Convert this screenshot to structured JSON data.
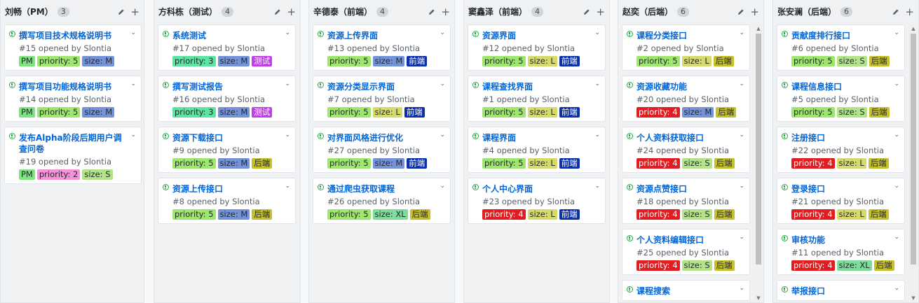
{
  "colors": {
    "pm": "#7ee57e",
    "priority5": "#9ee66e",
    "priority3": "#5ee3a0",
    "priority2": "#f693d8",
    "priority4": "#e11d21",
    "sizeM": "#7392d8",
    "sizeS": "#b2e389",
    "sizeL": "#d6d96b",
    "sizeXL": "#7fdc9b",
    "frontend": "#0b30a8",
    "backend": "#c6c02a",
    "test": "#c23ee6"
  },
  "columns": [
    {
      "title": "刘畅（PM）",
      "count": "3",
      "cards": [
        {
          "title": "撰写项目技术规格说明书",
          "meta": "#15 opened by Slontia",
          "labels": [
            {
              "text": "PM",
              "kind": "pm"
            },
            {
              "text": "priority: 5",
              "kind": "priority5"
            },
            {
              "text": "size: M",
              "kind": "sizeM"
            }
          ]
        },
        {
          "title": "撰写项目功能规格说明书",
          "meta": "#14 opened by Slontia",
          "labels": [
            {
              "text": "PM",
              "kind": "pm"
            },
            {
              "text": "priority: 5",
              "kind": "priority5"
            },
            {
              "text": "size: M",
              "kind": "sizeM"
            }
          ]
        },
        {
          "title": "发布Alpha阶段后期用户调查问卷",
          "meta": "#19 opened by Slontia",
          "labels": [
            {
              "text": "PM",
              "kind": "pm"
            },
            {
              "text": "priority: 2",
              "kind": "priority2"
            },
            {
              "text": "size: S",
              "kind": "sizeS"
            }
          ]
        }
      ]
    },
    {
      "title": "方科栋（测试）",
      "count": "4",
      "cards": [
        {
          "title": "系统测试",
          "meta": "#17 opened by Slontia",
          "labels": [
            {
              "text": "priority: 3",
              "kind": "priority3"
            },
            {
              "text": "size: M",
              "kind": "sizeM"
            },
            {
              "text": "测试",
              "kind": "test"
            }
          ]
        },
        {
          "title": "撰写测试报告",
          "meta": "#16 opened by Slontia",
          "labels": [
            {
              "text": "priority: 3",
              "kind": "priority3"
            },
            {
              "text": "size: M",
              "kind": "sizeM"
            },
            {
              "text": "测试",
              "kind": "test"
            }
          ]
        },
        {
          "title": "资源下载接口",
          "meta": "#9 opened by Slontia",
          "labels": [
            {
              "text": "priority: 5",
              "kind": "priority5"
            },
            {
              "text": "size: M",
              "kind": "sizeM"
            },
            {
              "text": "后端",
              "kind": "backend"
            }
          ]
        },
        {
          "title": "资源上传接口",
          "meta": "#8 opened by Slontia",
          "labels": [
            {
              "text": "priority: 5",
              "kind": "priority5"
            },
            {
              "text": "size: M",
              "kind": "sizeM"
            },
            {
              "text": "后端",
              "kind": "backend"
            }
          ]
        }
      ]
    },
    {
      "title": "辛德泰（前端）",
      "count": "4",
      "cards": [
        {
          "title": "资源上传界面",
          "meta": "#13 opened by Slontia",
          "labels": [
            {
              "text": "priority: 5",
              "kind": "priority5"
            },
            {
              "text": "size: M",
              "kind": "sizeM"
            },
            {
              "text": "前端",
              "kind": "frontend"
            }
          ]
        },
        {
          "title": "资源分类显示界面",
          "meta": "#7 opened by Slontia",
          "labels": [
            {
              "text": "priority: 5",
              "kind": "priority5"
            },
            {
              "text": "size: L",
              "kind": "sizeL"
            },
            {
              "text": "前端",
              "kind": "frontend"
            }
          ]
        },
        {
          "title": "对界面风格进行优化",
          "meta": "#27 opened by Slontia",
          "labels": [
            {
              "text": "priority: 5",
              "kind": "priority5"
            },
            {
              "text": "size: M",
              "kind": "sizeM"
            },
            {
              "text": "前端",
              "kind": "frontend"
            }
          ]
        },
        {
          "title": "通过爬虫获取课程",
          "meta": "#26 opened by Slontia",
          "labels": [
            {
              "text": "priority: 5",
              "kind": "priority5"
            },
            {
              "text": "size: XL",
              "kind": "sizeXL"
            },
            {
              "text": "后端",
              "kind": "backend"
            }
          ]
        }
      ]
    },
    {
      "title": "窦鑫泽（前端）",
      "count": "4",
      "cards": [
        {
          "title": "资源界面",
          "meta": "#12 opened by Slontia",
          "labels": [
            {
              "text": "priority: 5",
              "kind": "priority5"
            },
            {
              "text": "size: L",
              "kind": "sizeL"
            },
            {
              "text": "前端",
              "kind": "frontend"
            }
          ]
        },
        {
          "title": "课程查找界面",
          "meta": "#1 opened by Slontia",
          "labels": [
            {
              "text": "priority: 5",
              "kind": "priority5"
            },
            {
              "text": "size: L",
              "kind": "sizeL"
            },
            {
              "text": "前端",
              "kind": "frontend"
            }
          ]
        },
        {
          "title": "课程界面",
          "meta": "#4 opened by Slontia",
          "labels": [
            {
              "text": "priority: 5",
              "kind": "priority5"
            },
            {
              "text": "size: L",
              "kind": "sizeL"
            },
            {
              "text": "前端",
              "kind": "frontend"
            }
          ]
        },
        {
          "title": "个人中心界面",
          "meta": "#23 opened by Slontia",
          "labels": [
            {
              "text": "priority: 4",
              "kind": "priority4"
            },
            {
              "text": "size: L",
              "kind": "sizeL"
            },
            {
              "text": "前端",
              "kind": "frontend"
            }
          ]
        }
      ]
    },
    {
      "title": "赵奕（后端）",
      "count": "6",
      "cards": [
        {
          "title": "课程分类接口",
          "meta": "#2 opened by Slontia",
          "labels": [
            {
              "text": "priority: 5",
              "kind": "priority5"
            },
            {
              "text": "size: L",
              "kind": "sizeL"
            },
            {
              "text": "后端",
              "kind": "backend"
            }
          ]
        },
        {
          "title": "资源收藏功能",
          "meta": "#20 opened by Slontia",
          "labels": [
            {
              "text": "priority: 4",
              "kind": "priority4"
            },
            {
              "text": "size: M",
              "kind": "sizeM"
            },
            {
              "text": "后端",
              "kind": "backend"
            }
          ]
        },
        {
          "title": "个人资料获取接口",
          "meta": "#24 opened by Slontia",
          "labels": [
            {
              "text": "priority: 4",
              "kind": "priority4"
            },
            {
              "text": "size: S",
              "kind": "sizeS"
            },
            {
              "text": "后端",
              "kind": "backend"
            }
          ]
        },
        {
          "title": "资源点赞接口",
          "meta": "#18 opened by Slontia",
          "labels": [
            {
              "text": "priority: 4",
              "kind": "priority4"
            },
            {
              "text": "size: S",
              "kind": "sizeS"
            },
            {
              "text": "后端",
              "kind": "backend"
            }
          ]
        },
        {
          "title": "个人资料编辑接口",
          "meta": "#25 opened by Slontia",
          "labels": [
            {
              "text": "priority: 4",
              "kind": "priority4"
            },
            {
              "text": "size: S",
              "kind": "sizeS"
            },
            {
              "text": "后端",
              "kind": "backend"
            }
          ]
        },
        {
          "title": "课程搜索",
          "meta": "",
          "labels": []
        }
      ]
    },
    {
      "title": "张安澜（后端）",
      "count": "6",
      "cards": [
        {
          "title": "贡献度排行接口",
          "meta": "#6 opened by Slontia",
          "labels": [
            {
              "text": "priority: 5",
              "kind": "priority5"
            },
            {
              "text": "size: S",
              "kind": "sizeS"
            },
            {
              "text": "后端",
              "kind": "backend"
            }
          ]
        },
        {
          "title": "课程信息接口",
          "meta": "#5 opened by Slontia",
          "labels": [
            {
              "text": "priority: 5",
              "kind": "priority5"
            },
            {
              "text": "size: S",
              "kind": "sizeS"
            },
            {
              "text": "后端",
              "kind": "backend"
            }
          ]
        },
        {
          "title": "注册接口",
          "meta": "#22 opened by Slontia",
          "labels": [
            {
              "text": "priority: 4",
              "kind": "priority4"
            },
            {
              "text": "size: L",
              "kind": "sizeL"
            },
            {
              "text": "后端",
              "kind": "backend"
            }
          ]
        },
        {
          "title": "登录接口",
          "meta": "#21 opened by Slontia",
          "labels": [
            {
              "text": "priority: 4",
              "kind": "priority4"
            },
            {
              "text": "size: L",
              "kind": "sizeL"
            },
            {
              "text": "后端",
              "kind": "backend"
            }
          ]
        },
        {
          "title": "审核功能",
          "meta": "#11 opened by Slontia",
          "labels": [
            {
              "text": "priority: 4",
              "kind": "priority4"
            },
            {
              "text": "size: XL",
              "kind": "sizeXL"
            },
            {
              "text": "后端",
              "kind": "backend"
            }
          ]
        },
        {
          "title": "举报接口",
          "meta": "",
          "labels": []
        }
      ]
    }
  ]
}
